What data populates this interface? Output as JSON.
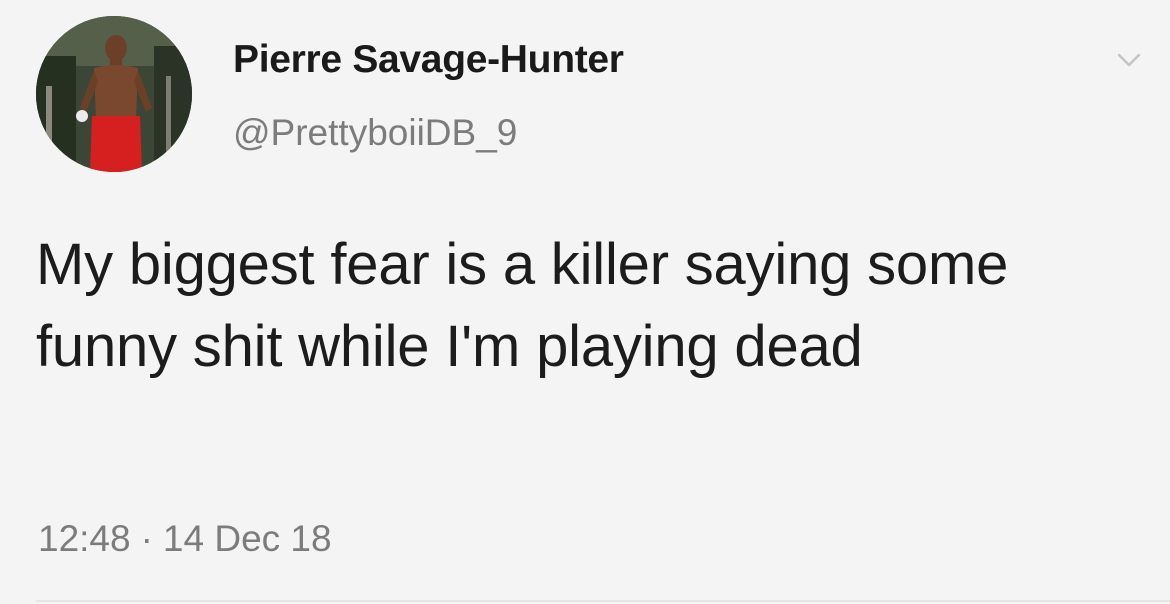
{
  "tweet": {
    "author": {
      "display_name": "Pierre Savage-Hunter",
      "handle": "@PrettyboiiDB_9"
    },
    "text": "My biggest fear is a killer saying some funny shit while I'm playing dead",
    "time": "12:48",
    "separator": "·",
    "date": "14 Dec 18"
  },
  "icons": {
    "menu": "chevron-down-icon"
  }
}
